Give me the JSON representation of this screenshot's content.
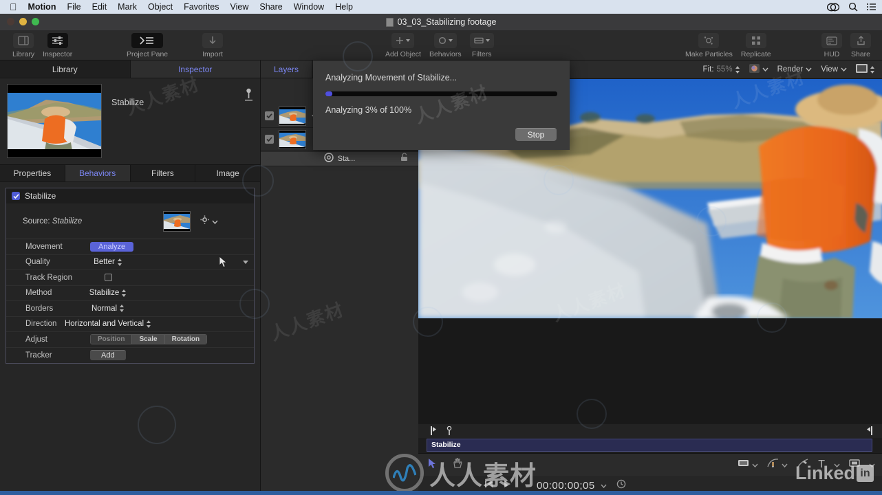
{
  "menubar": {
    "apple_icon": "apple-icon",
    "items": [
      {
        "label": "Motion",
        "bold": true
      },
      {
        "label": "File",
        "bold": false
      },
      {
        "label": "Edit",
        "bold": false
      },
      {
        "label": "Mark",
        "bold": false
      },
      {
        "label": "Object",
        "bold": false
      },
      {
        "label": "Favorites",
        "bold": false
      },
      {
        "label": "View",
        "bold": false
      },
      {
        "label": "Share",
        "bold": false
      },
      {
        "label": "Window",
        "bold": false
      },
      {
        "label": "Help",
        "bold": false
      }
    ],
    "status_icons": [
      "creative-cloud-icon",
      "spotlight-search-icon",
      "control-center-icon"
    ]
  },
  "window": {
    "title": "03_03_Stabilizing footage"
  },
  "toolbar": {
    "left": [
      {
        "label": "Library",
        "icon": "library-icon",
        "active": false
      },
      {
        "label": "Inspector",
        "icon": "inspector-icon",
        "active": true
      },
      {
        "label": "Project Pane",
        "icon": "project-pane-icon",
        "active": true
      },
      {
        "label": "Import",
        "icon": "import-icon",
        "active": false
      }
    ],
    "center": [
      {
        "label": "Add Object",
        "icon": "plus-icon"
      },
      {
        "label": "Behaviors",
        "icon": "behaviors-icon"
      },
      {
        "label": "Filters",
        "icon": "filters-icon"
      }
    ],
    "right": [
      {
        "label": "Make Particles",
        "icon": "make-particles-icon"
      },
      {
        "label": "Replicate",
        "icon": "replicate-icon"
      },
      {
        "label": "HUD",
        "icon": "hud-icon"
      },
      {
        "label": "Share",
        "icon": "share-icon"
      }
    ]
  },
  "left_panel": {
    "tabs": [
      {
        "label": "Library",
        "active": false
      },
      {
        "label": "Inspector",
        "active": true
      }
    ],
    "object_name": "Stabilize",
    "pin_icon": "pin-icon",
    "sub_tabs": [
      {
        "label": "Properties",
        "active": false
      },
      {
        "label": "Behaviors",
        "active": true
      },
      {
        "label": "Filters",
        "active": false
      },
      {
        "label": "Image",
        "active": false
      }
    ],
    "behavior": {
      "enabled": true,
      "title": "Stabilize",
      "source_label": "Source:",
      "source_value": "Stabilize",
      "gear_icon": "gear-icon",
      "rows": [
        {
          "label": "Movement",
          "type": "button-blue",
          "value": "Analyze"
        },
        {
          "label": "Quality",
          "type": "popup",
          "value": "Better"
        },
        {
          "label": "Track Region",
          "type": "checkbox",
          "value": ""
        },
        {
          "label": "Method",
          "type": "popup",
          "value": "Stabilize"
        },
        {
          "label": "Borders",
          "type": "popup",
          "value": "Normal"
        },
        {
          "label": "Direction",
          "type": "popup",
          "value": "Horizontal and Vertical"
        },
        {
          "label": "Adjust",
          "type": "segments",
          "value": ""
        },
        {
          "label": "Tracker",
          "type": "button-gray",
          "value": "Add"
        }
      ],
      "adjust_segments": [
        {
          "label": "Position",
          "on": false
        },
        {
          "label": "Scale",
          "on": true
        },
        {
          "label": "Rotation",
          "on": true
        }
      ]
    }
  },
  "layers_panel": {
    "tab_label": "Layers",
    "rows": [
      {
        "checked": true,
        "has_disclosure": true
      },
      {
        "checked": true,
        "has_disclosure": false
      }
    ],
    "behavior_row": {
      "checked": true,
      "icon": "behavior-gear-icon",
      "name": "Sta...",
      "lock_icon": "lock-icon"
    },
    "bottom_icons": [
      "search-icon",
      "new-group-icon",
      "pattern-icon",
      "mask-icon",
      "layer-icon"
    ],
    "footer_icons": [
      "mute-icon",
      "loop-icon",
      "record-icon"
    ]
  },
  "canvas": {
    "fit_label": "Fit:",
    "fit_value": "55%",
    "color_icon": "color-wheel-icon",
    "render_label": "Render",
    "view_label": "View",
    "background_icon": "background-swatch-icon",
    "timeline": {
      "track_name": "Stabilize",
      "playhead_icon": "playhead-icon",
      "marker_icon": "marker-icon"
    },
    "toolbar_icons": [
      "select-arrow-icon",
      "pan-hand-icon",
      "crop-icon",
      "shape-icon",
      "bezier-pen-icon",
      "paint-stroke-icon",
      "text-icon",
      "mask-rect-icon"
    ],
    "timecode": "00:00:00;05",
    "timecode_clock_icon": "clock-icon",
    "transport_icons": [
      "go-to-start-icon",
      "play-icon"
    ]
  },
  "dialog": {
    "title": "Analyzing Movement of Stabilize...",
    "status": "Analyzing 3% of 100%",
    "progress_percent": 3,
    "progress_color": "#4f4fe0",
    "stop_label": "Stop"
  },
  "watermarks": {
    "brand_cn": "人人素材",
    "linkedin_word": "Linked",
    "linkedin_box": "in"
  }
}
